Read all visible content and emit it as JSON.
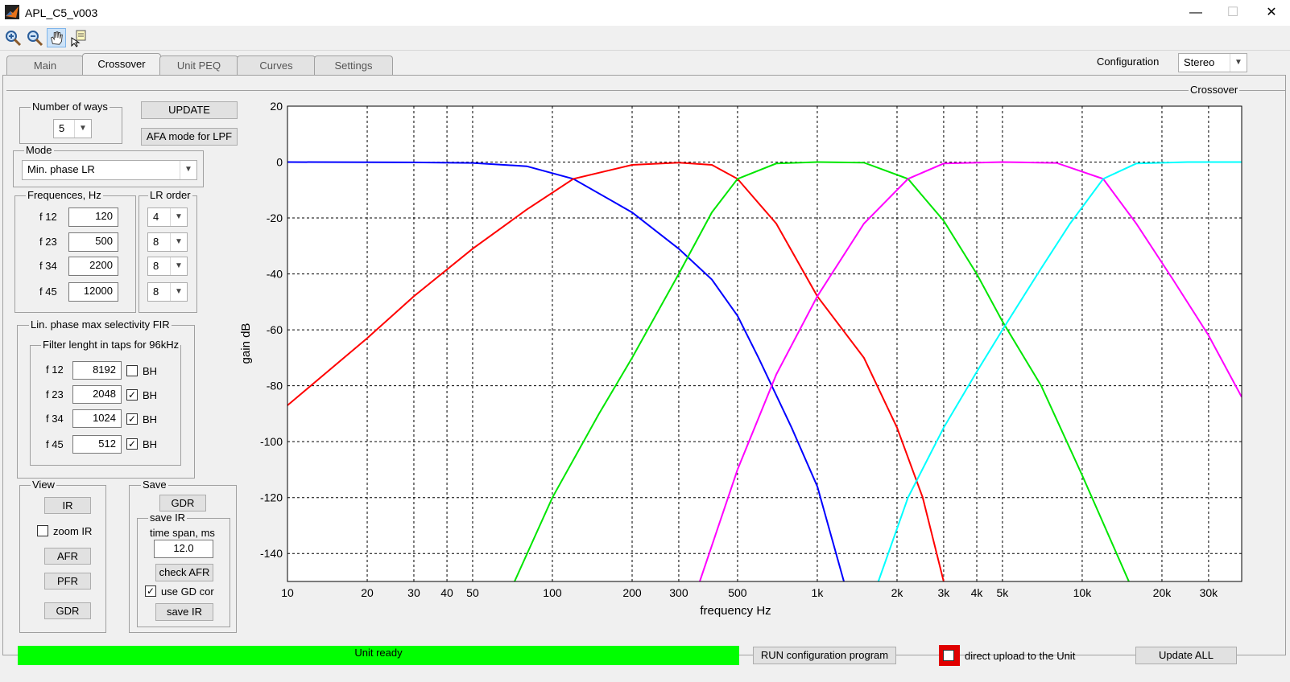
{
  "window": {
    "title": "APL_C5_v003",
    "minimize": "—",
    "maximize": "☐",
    "close": "✕"
  },
  "toolbar": {
    "zoom_in": "zoom-in-icon",
    "zoom_out": "zoom-out-icon",
    "pan": "pan-hand-icon",
    "data_cursor": "data-cursor-icon"
  },
  "tabs": [
    "Main",
    "Crossover",
    "Unit PEQ",
    "Curves",
    "Settings"
  ],
  "configuration": {
    "label": "Configuration",
    "value": "Stereo"
  },
  "panel_title": "Crossover",
  "ways": {
    "label": "Number of ways",
    "value": "5"
  },
  "buttons": {
    "update": "UPDATE",
    "afa": "AFA mode for LPF"
  },
  "mode": {
    "label": "Mode",
    "value": "Min. phase LR"
  },
  "freq": {
    "label": "Frequences, Hz",
    "lr_label": "LR order",
    "rows": [
      {
        "name": "f 12",
        "value": "120",
        "order": "4"
      },
      {
        "name": "f 23",
        "value": "500",
        "order": "8"
      },
      {
        "name": "f 34",
        "value": "2200",
        "order": "8"
      },
      {
        "name": "f 45",
        "value": "12000",
        "order": "8"
      }
    ]
  },
  "fir": {
    "label": "Lin. phase max selectivity FIR",
    "sub_label": "Filter lenght in taps for 96kHz",
    "bh": "BH",
    "rows": [
      {
        "name": "f 12",
        "value": "8192",
        "bh": ""
      },
      {
        "name": "f 23",
        "value": "2048",
        "bh": "✓"
      },
      {
        "name": "f 34",
        "value": "1024",
        "bh": "✓"
      },
      {
        "name": "f 45",
        "value": "512",
        "bh": "✓"
      }
    ]
  },
  "view": {
    "label": "View",
    "ir": "IR",
    "zoom_ir": "zoom IR",
    "afr": "AFR",
    "pfr": "PFR",
    "gdr": "GDR"
  },
  "save": {
    "label": "Save",
    "gdr": "GDR",
    "save_ir_label": "save IR",
    "time_span_label": "time span, ms",
    "time_span": "12.0",
    "check_afr": "check AFR",
    "use_gd_cor": "use GD cor",
    "use_gd_cor_check": "✓",
    "save_ir": "save IR"
  },
  "status": "Unit ready",
  "run_button": "RUN configuration program",
  "direct_upload": "direct upload to the Unit",
  "update_all": "Update ALL",
  "chart_data": {
    "type": "line",
    "xlabel": "frequency   Hz",
    "ylabel": "gain dB",
    "xscale": "log",
    "xlim": [
      10,
      40000
    ],
    "ylim": [
      -150,
      20
    ],
    "grid": true,
    "xticks": [
      10,
      20,
      30,
      40,
      50,
      100,
      200,
      300,
      500,
      1000,
      2000,
      3000,
      4000,
      5000,
      10000,
      20000,
      30000
    ],
    "xtick_labels": [
      "10",
      "20",
      "30",
      "40",
      "50",
      "100",
      "200",
      "300",
      "500",
      "1k",
      "2k",
      "3k",
      "4k",
      "5k",
      "10k",
      "20k",
      "30k"
    ],
    "yticks": [
      20,
      0,
      -20,
      -40,
      -60,
      -80,
      -100,
      -120,
      -140
    ],
    "series": [
      {
        "color": "#0000ff",
        "points": [
          [
            10,
            0
          ],
          [
            30,
            -0.1
          ],
          [
            50,
            -0.3
          ],
          [
            80,
            -1.5
          ],
          [
            120,
            -6
          ],
          [
            200,
            -18
          ],
          [
            300,
            -31
          ],
          [
            400,
            -42
          ],
          [
            500,
            -55
          ],
          [
            600,
            -70
          ],
          [
            800,
            -95
          ],
          [
            1000,
            -116
          ],
          [
            1260,
            -150
          ]
        ]
      },
      {
        "color": "#ff0000",
        "points": [
          [
            10,
            -87
          ],
          [
            20,
            -63
          ],
          [
            30,
            -48
          ],
          [
            50,
            -31
          ],
          [
            80,
            -17
          ],
          [
            120,
            -6
          ],
          [
            200,
            -1
          ],
          [
            300,
            -0.2
          ],
          [
            400,
            -1
          ],
          [
            500,
            -6
          ],
          [
            700,
            -22
          ],
          [
            1000,
            -48
          ],
          [
            1500,
            -70
          ],
          [
            2000,
            -95
          ],
          [
            2500,
            -120
          ],
          [
            3000,
            -150
          ]
        ]
      },
      {
        "color": "#00e600",
        "points": [
          [
            72,
            -150
          ],
          [
            100,
            -120
          ],
          [
            150,
            -90
          ],
          [
            200,
            -70
          ],
          [
            300,
            -40
          ],
          [
            400,
            -18
          ],
          [
            500,
            -6
          ],
          [
            700,
            -0.5
          ],
          [
            1000,
            0
          ],
          [
            1500,
            -0.2
          ],
          [
            2200,
            -6
          ],
          [
            3000,
            -21
          ],
          [
            4000,
            -40
          ],
          [
            5000,
            -57
          ],
          [
            7000,
            -80
          ],
          [
            10000,
            -112
          ],
          [
            15000,
            -150
          ]
        ]
      },
      {
        "color": "#ff00ff",
        "points": [
          [
            360,
            -150
          ],
          [
            500,
            -110
          ],
          [
            700,
            -76
          ],
          [
            1000,
            -48
          ],
          [
            1500,
            -22
          ],
          [
            2200,
            -6
          ],
          [
            3000,
            -0.5
          ],
          [
            5000,
            0
          ],
          [
            8000,
            -0.3
          ],
          [
            12000,
            -6
          ],
          [
            16000,
            -22
          ],
          [
            22000,
            -42
          ],
          [
            30000,
            -62
          ],
          [
            40000,
            -84
          ]
        ]
      },
      {
        "color": "#00ffff",
        "points": [
          [
            1700,
            -150
          ],
          [
            2200,
            -120
          ],
          [
            3000,
            -95
          ],
          [
            4000,
            -75
          ],
          [
            5000,
            -60
          ],
          [
            7000,
            -38
          ],
          [
            9000,
            -22
          ],
          [
            12000,
            -6
          ],
          [
            16000,
            -0.5
          ],
          [
            25000,
            0
          ],
          [
            40000,
            0
          ]
        ]
      }
    ]
  }
}
